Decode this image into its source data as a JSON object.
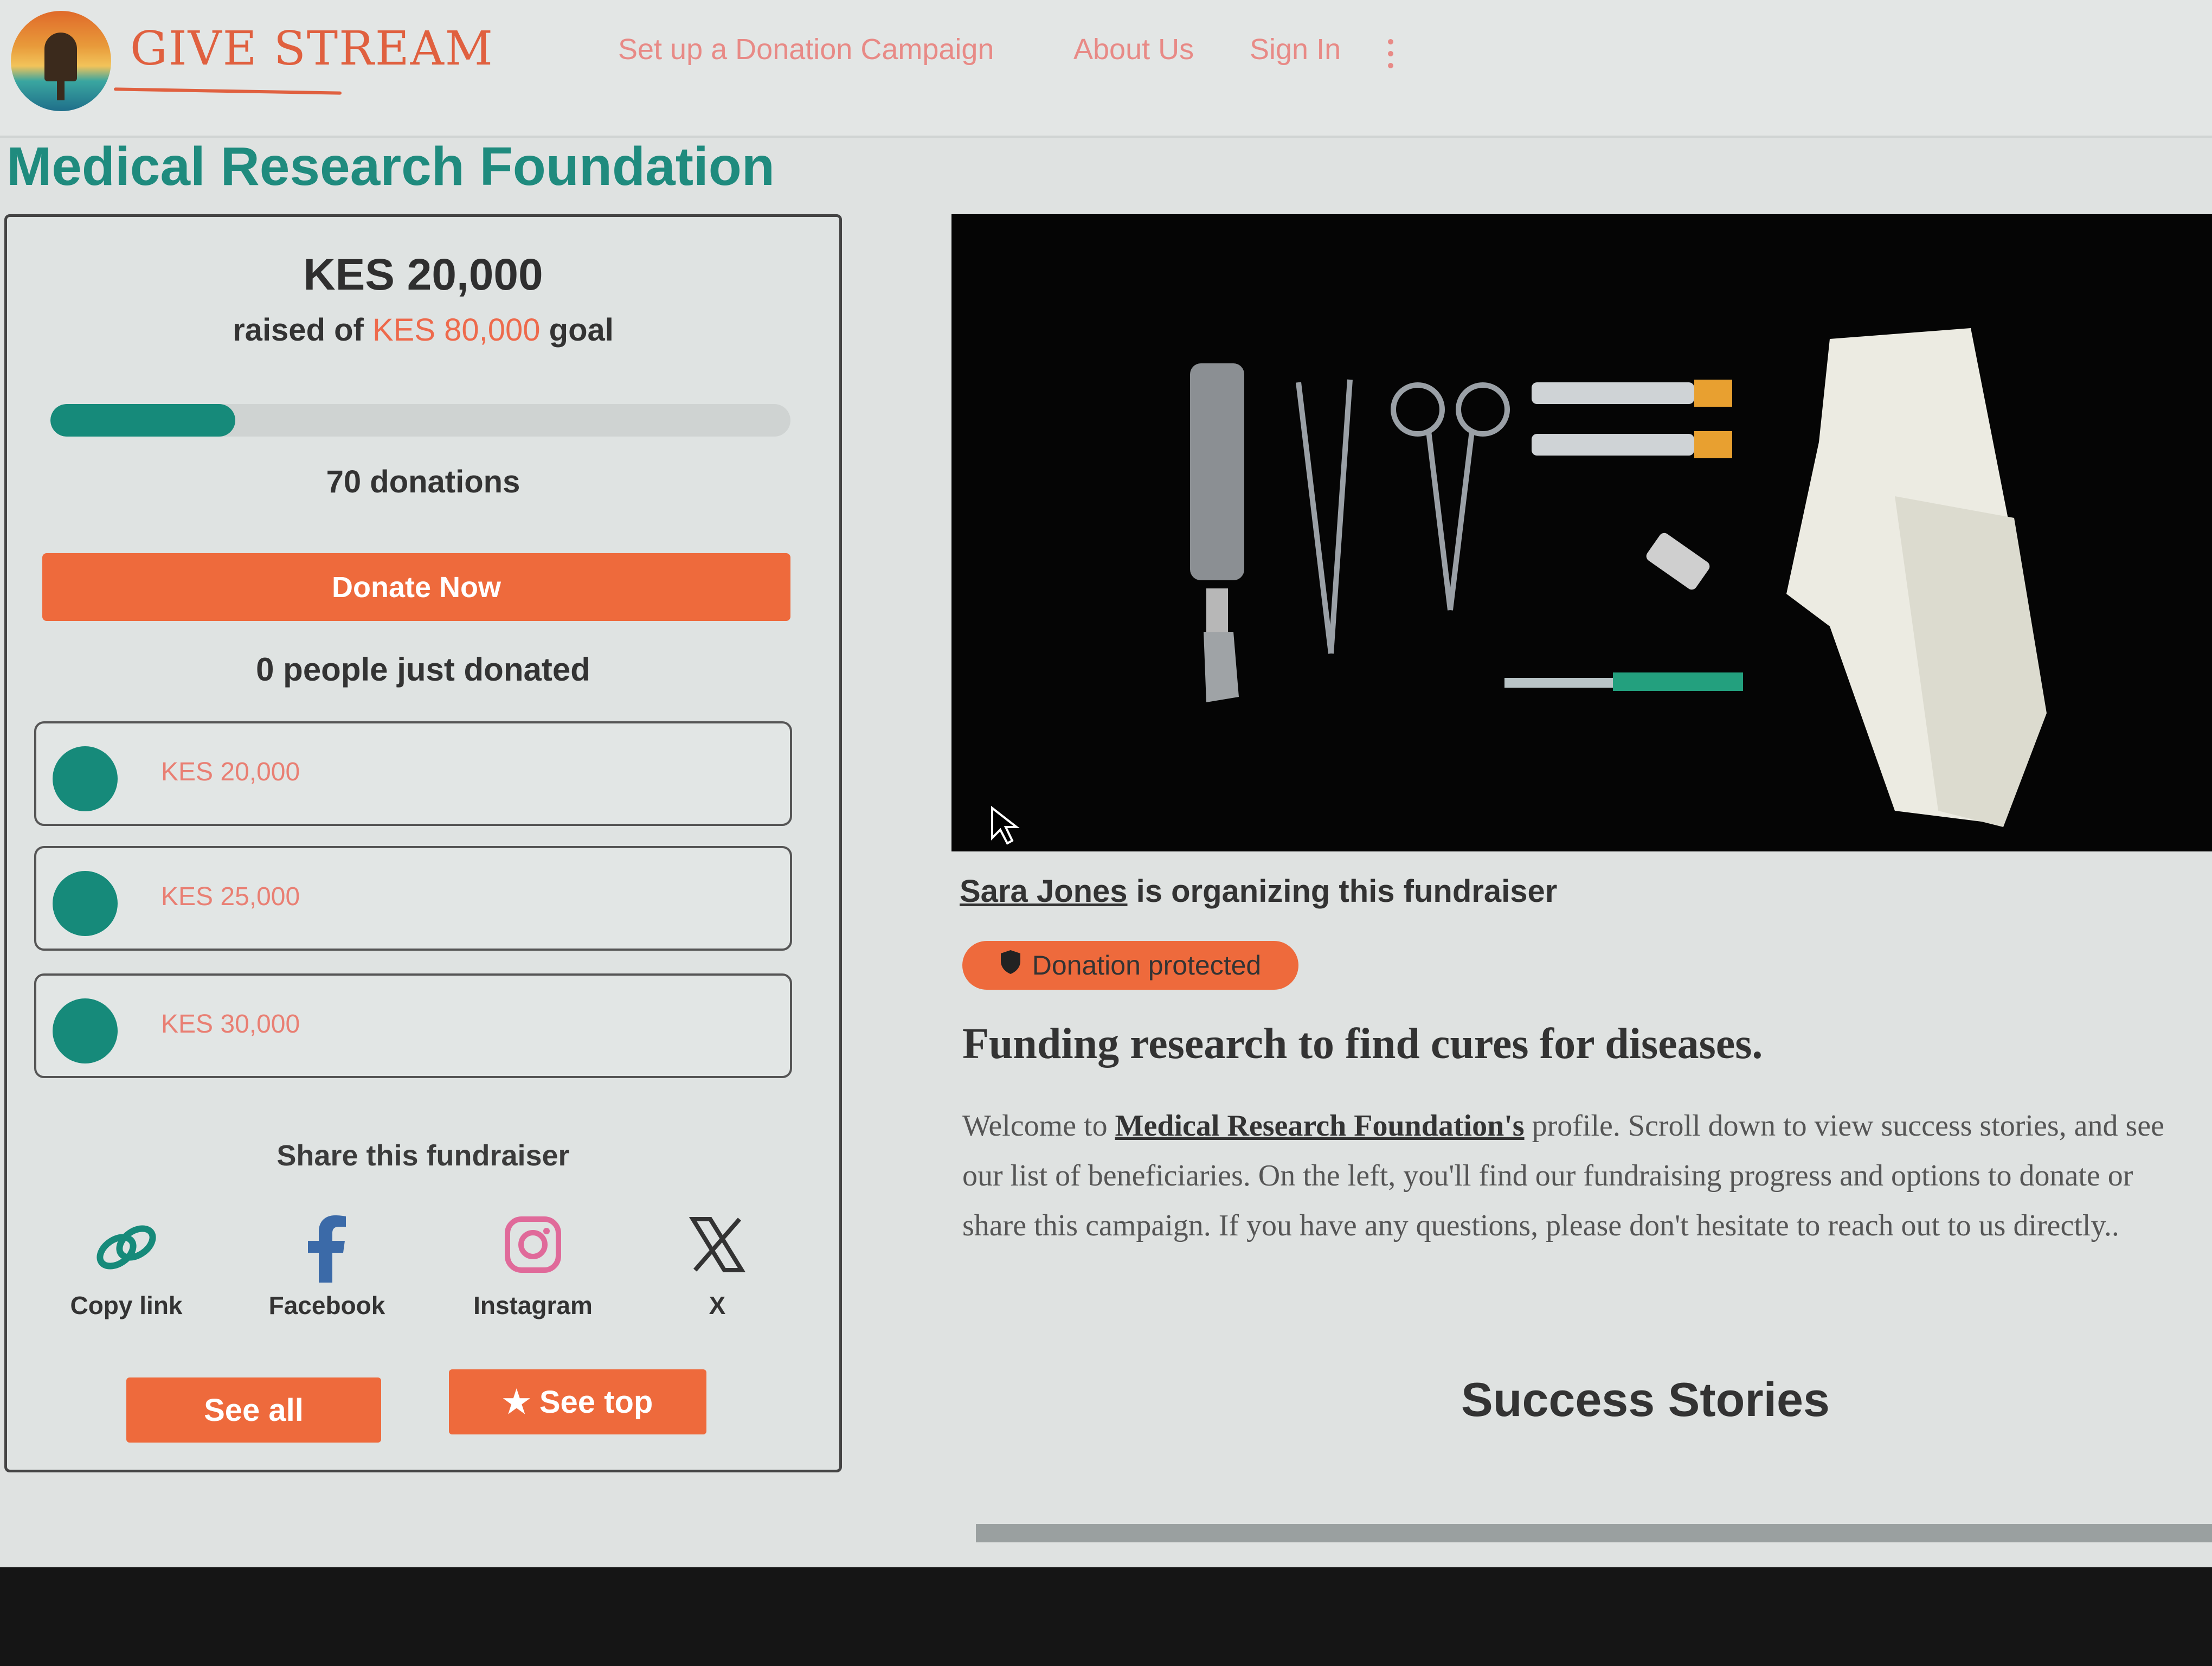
{
  "header": {
    "logo_text": "GIVE STREAM",
    "nav": [
      "Set up a Donation Campaign",
      "About Us",
      "Sign In"
    ]
  },
  "page_title": "Medical Research Foundation",
  "sidebar": {
    "raised_amount": "KES 20,000",
    "raised_prefix": "raised of ",
    "goal_amount": "KES 80,000",
    "goal_suffix": " goal",
    "progress_fraction": 0.25,
    "donations_count": "70 donations",
    "donate_label": "Donate Now",
    "just_donated": "0 people just donated",
    "amounts": [
      "KES 20,000",
      "KES 25,000",
      "KES 30,000"
    ],
    "share_title": "Share this fundraiser",
    "share": {
      "copy": "Copy link",
      "facebook": "Facebook",
      "instagram": "Instagram",
      "x": "X"
    },
    "see_all": "See all",
    "see_top": "See top"
  },
  "main": {
    "organizer_name": "Sara Jones",
    "organizer_suffix": " is organizing this fundraiser",
    "protected_label": "Donation protected",
    "subtitle": "Funding research to find cures for diseases.",
    "desc_prefix": "Welcome to ",
    "desc_org": "Medical Research Foundation's",
    "desc_rest": " profile. Scroll down to view success stories, and see our list of beneficiaries. On the left, you'll find our fundraising progress and options to donate or share this campaign. If you have any questions, please don't hesitate to reach out to us directly..",
    "success_title": "Success Stories"
  },
  "colors": {
    "accent_teal": "#168a7a",
    "accent_orange": "#ee6a3c"
  }
}
